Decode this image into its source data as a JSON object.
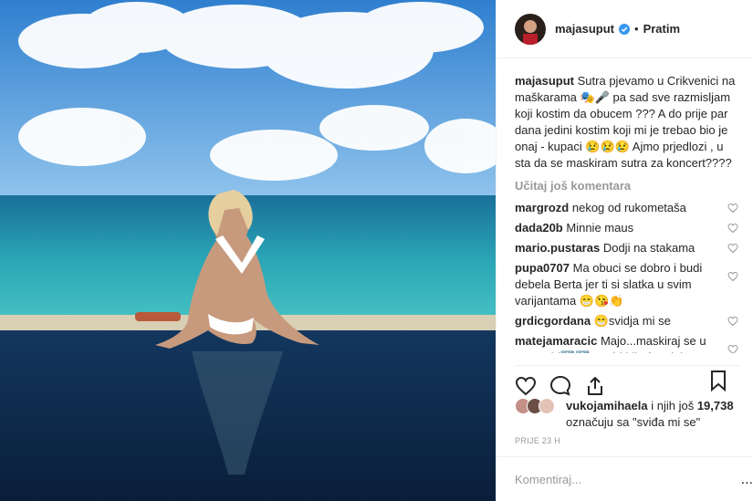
{
  "post": {
    "username": "majasuput",
    "follow_label": "Pratim",
    "dot": "•",
    "caption_user": "majasuput",
    "caption_text": "Sutra pjevamo u Crikvenici na maškarama 🎭🎤 pa sad sve razmisljam koji kostim da obucem ??? A do prije par dana jedini kostim koji mi je trebao bio je onaj - kupaci 😢😢😢 Ajmo prjedlozi , u sta da se maskiram sutra za koncert????",
    "load_more": "Učitaj još komentara",
    "comments": [
      {
        "user": "margrozd",
        "text": "nekog od rukometaša"
      },
      {
        "user": "dada20b",
        "text": "Minnie maus"
      },
      {
        "user": "mario.pustaras",
        "text": "Dodji na stakama"
      },
      {
        "user": "pupa0707",
        "text": "Ma obuci se dobro i budi debela Berta jer ti si slatka u svim varijantama 😁😘👏"
      },
      {
        "user": "grdicgordana",
        "text": "😁svidja mi se"
      },
      {
        "user": "matejamaracic",
        "text": "Majo...maskiraj se u supergirl🔝🔝...to bi bilo fora jako..."
      }
    ],
    "likes_user": "vukojamihaela",
    "likes_mid": "i njih još",
    "likes_count": "19,738",
    "likes_suffix": "označuju sa \"sviđa mi se\"",
    "timestamp": "PRIJE 23 H",
    "comment_placeholder": "Komentiraj...",
    "more_dots": "..."
  },
  "icons": [
    "heart-icon",
    "comment-icon",
    "share-icon",
    "bookmark-icon",
    "verified-icon"
  ],
  "colors": {
    "verified": "#3897f0",
    "muted": "#999999",
    "text": "#262626"
  }
}
